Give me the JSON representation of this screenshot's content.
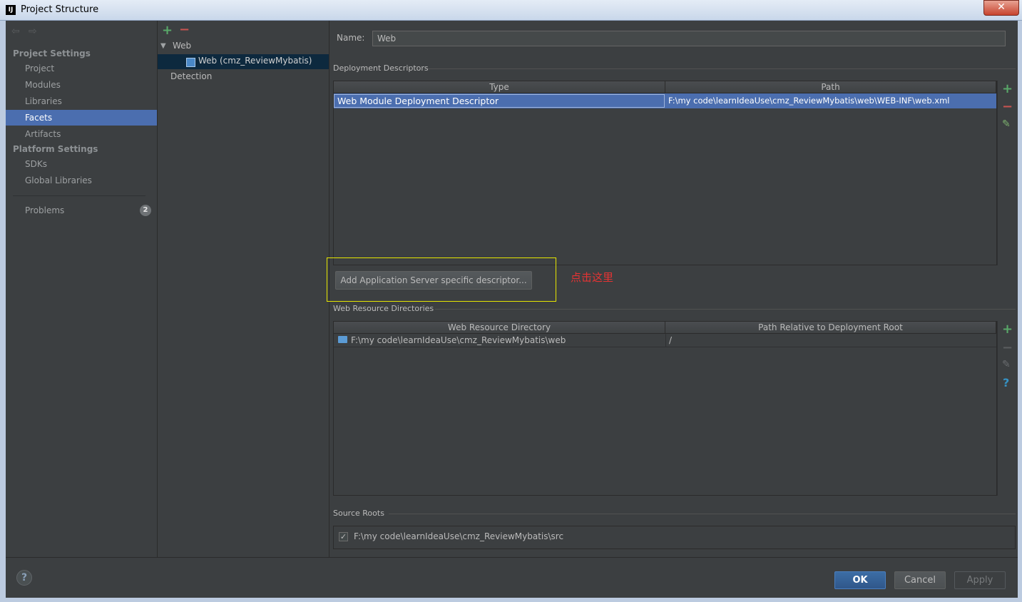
{
  "window": {
    "title": "Project Structure",
    "close": "✕"
  },
  "sidebar": {
    "project_settings": "Project Settings",
    "items_project": [
      {
        "label": "Project"
      },
      {
        "label": "Modules"
      },
      {
        "label": "Libraries"
      },
      {
        "label": "Facets"
      },
      {
        "label": "Artifacts"
      }
    ],
    "platform_settings": "Platform Settings",
    "items_platform": [
      {
        "label": "SDKs"
      },
      {
        "label": "Global Libraries"
      }
    ],
    "problems": {
      "label": "Problems",
      "count": "2"
    }
  },
  "tree": {
    "root": "Web",
    "child": "Web (cmz_ReviewMybatis)",
    "detection": "Detection"
  },
  "main": {
    "name_label": "Name:",
    "name_value": "Web",
    "deployment": {
      "title": "Deployment Descriptors",
      "columns": [
        "Type",
        "Path"
      ],
      "rows": [
        {
          "type": "Web Module Deployment Descriptor",
          "path": "F:\\my code\\learnIdeaUse\\cmz_ReviewMybatis\\web\\WEB-INF\\web.xml"
        }
      ]
    },
    "add_server_button": "Add Application Server specific descriptor...",
    "annotation": "点击这里",
    "web_resources": {
      "title": "Web Resource Directories",
      "columns": [
        "Web Resource Directory",
        "Path Relative to Deployment Root"
      ],
      "rows": [
        {
          "dir": "F:\\my code\\learnIdeaUse\\cmz_ReviewMybatis\\web",
          "path": "/"
        }
      ]
    },
    "source_roots": {
      "title": "Source Roots",
      "item": "F:\\my code\\learnIdeaUse\\cmz_ReviewMybatis\\src",
      "checked": true
    }
  },
  "buttons": {
    "help": "?",
    "ok": "OK",
    "cancel": "Cancel",
    "apply": "Apply"
  },
  "colors": {
    "selection": "#4b6eaf",
    "tree_selection": "#0d293e",
    "annotation": "#e53333",
    "highlight_box": "#e6e600"
  }
}
